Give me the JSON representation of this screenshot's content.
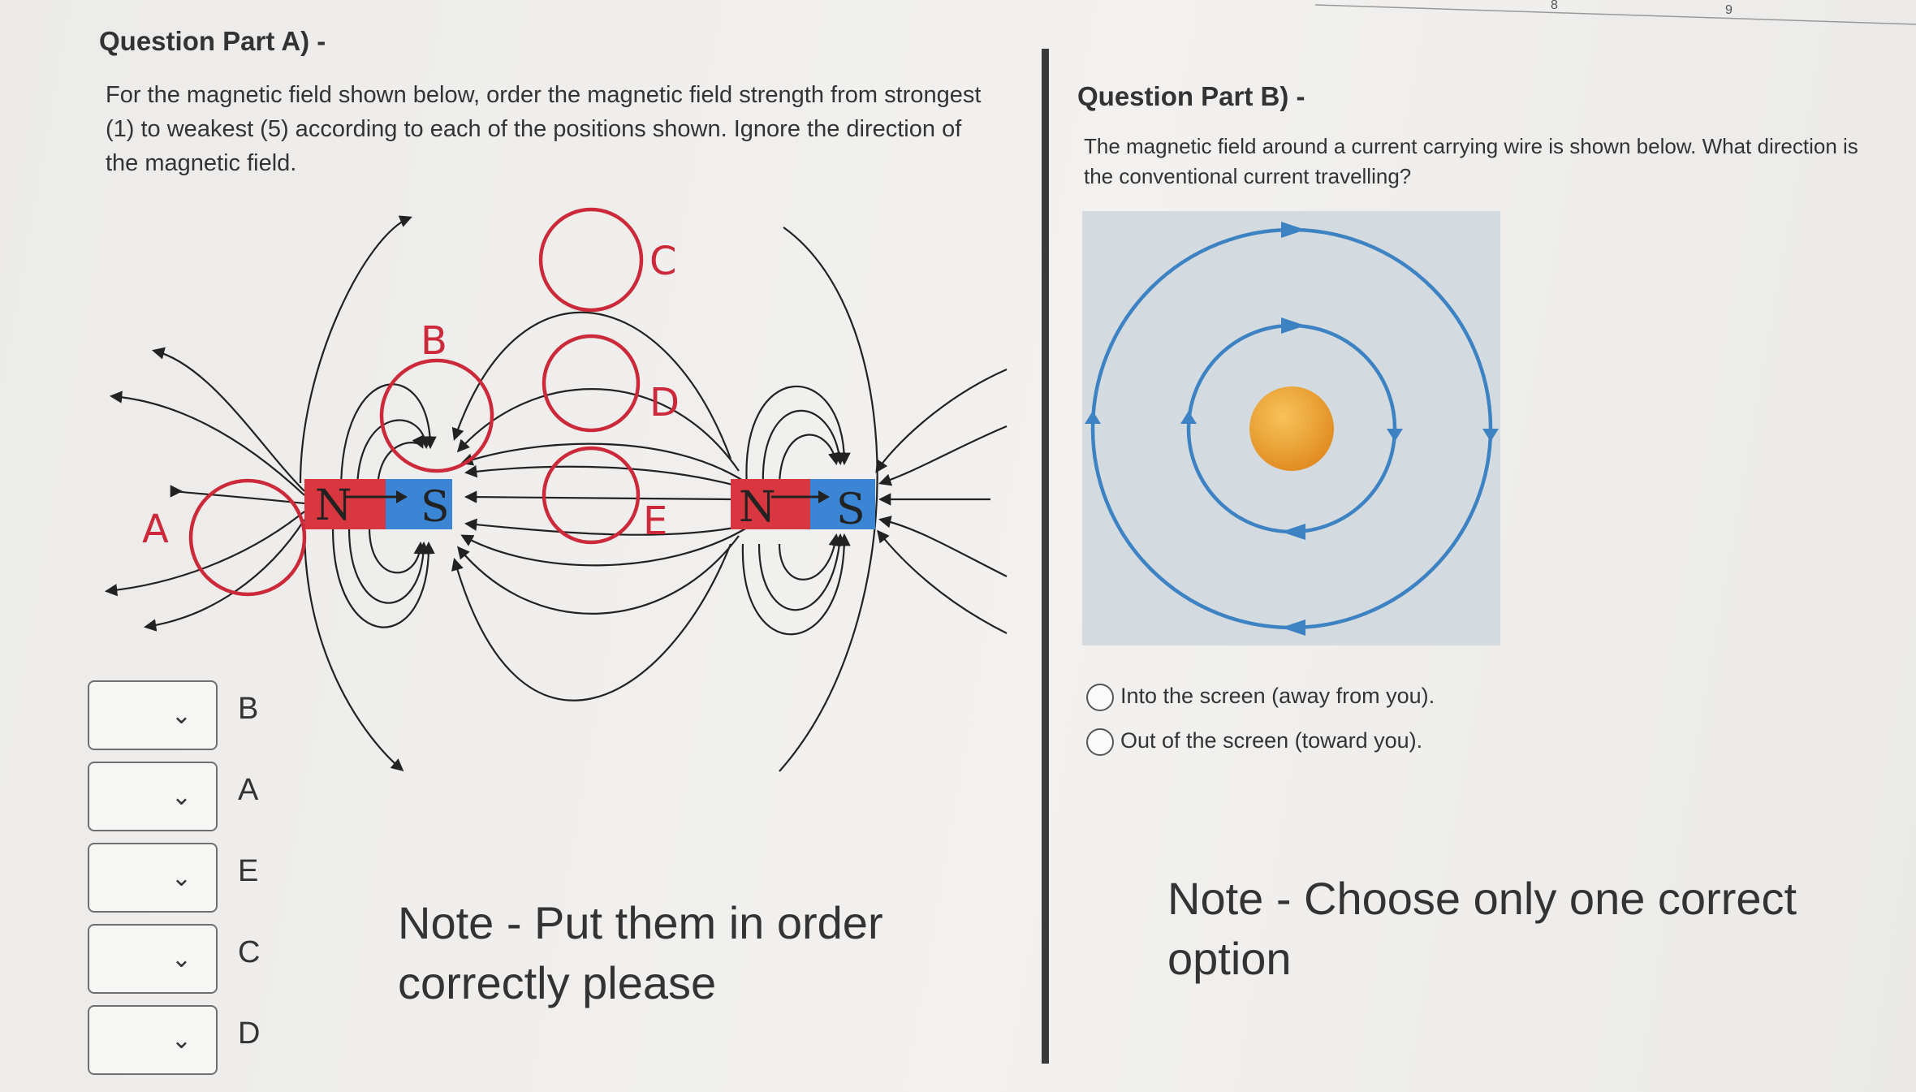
{
  "ruler_numbers": [
    "8",
    "9"
  ],
  "part_a": {
    "title": "Question Part A) -",
    "instructions": [
      "For the magnetic field shown below, order the magnetic field strength from strongest",
      "(1) to weakest (5) according to each of the positions shown. Ignore the direction of",
      "the magnetic field."
    ],
    "diagram": {
      "magnet_left": {
        "north": "N",
        "south": "S"
      },
      "magnet_right": {
        "north": "N",
        "south": "S"
      },
      "points": [
        "A",
        "B",
        "C",
        "D",
        "E"
      ],
      "colors": {
        "north": "#d9373f",
        "south": "#3a86d4",
        "circle": "#cc2a3a",
        "line": "#222222"
      }
    },
    "rank_rows": [
      {
        "label": "B",
        "value": ""
      },
      {
        "label": "A",
        "value": ""
      },
      {
        "label": "E",
        "value": ""
      },
      {
        "label": "C",
        "value": ""
      },
      {
        "label": "D",
        "value": ""
      }
    ],
    "note": [
      "Note - Put them in order",
      "correctly please"
    ]
  },
  "part_b": {
    "title": "Question Part B) -",
    "question": [
      "The magnetic field around a current carrying wire is shown below. What direction is",
      "the conventional current travelling?"
    ],
    "diagram": {
      "colors": {
        "field": "#3d82c2",
        "wire": "#e89a2a",
        "background": "#d3dbe0"
      }
    },
    "options": [
      {
        "label": "Into the screen (away from you).",
        "selected": false
      },
      {
        "label": "Out of the screen (toward you).",
        "selected": false
      }
    ],
    "note": [
      "Note - Choose only one correct",
      "option"
    ]
  }
}
